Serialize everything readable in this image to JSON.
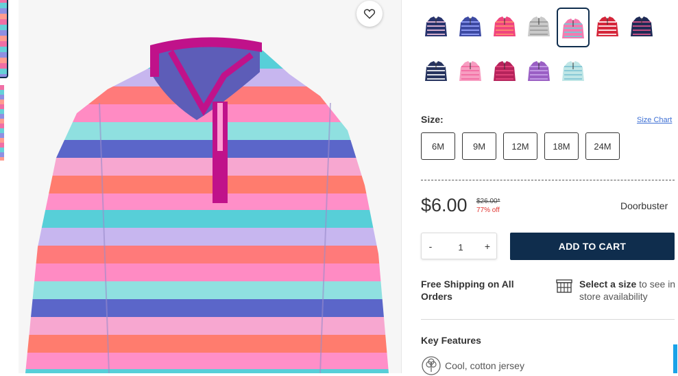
{
  "favorite": {
    "icon": "heart-icon"
  },
  "swatches": [
    {
      "name": "navy-unicorn",
      "color": "#27336d",
      "pattern": "#f6c6de"
    },
    {
      "name": "navy-print",
      "color": "#3d4aa3",
      "pattern": "#9aa6ff"
    },
    {
      "name": "pink-colorblock",
      "color": "#f0457e",
      "pattern": "#ff8f6d"
    },
    {
      "name": "gray-heart",
      "color": "#c9c9c9",
      "pattern": "#9b9b9b"
    },
    {
      "name": "rainbow-stripe",
      "color": "#f27bb0",
      "pattern": "#6fd0d8",
      "selected": true
    },
    {
      "name": "red-fairisle",
      "color": "#d5263a",
      "pattern": "#ffffff"
    },
    {
      "name": "navy-dot",
      "color": "#1f2b56",
      "pattern": "#e0568a"
    },
    {
      "name": "navy-stripe",
      "color": "#26335e",
      "pattern": "#ffffff"
    },
    {
      "name": "light-pink",
      "color": "#f79dc1",
      "pattern": "#f26aa0"
    },
    {
      "name": "berry-heart",
      "color": "#b6235b",
      "pattern": "#e5457c"
    },
    {
      "name": "purple-colorblock",
      "color": "#9a5fc4",
      "pattern": "#c8a3ea"
    },
    {
      "name": "mint-print",
      "color": "#bfe6e6",
      "pattern": "#7fc3d2"
    }
  ],
  "size": {
    "label": "Size:",
    "chart_link": "Size Chart",
    "options": [
      "6M",
      "9M",
      "12M",
      "18M",
      "24M"
    ]
  },
  "price": {
    "current": "$6.00",
    "original": "$26.00*",
    "discount": "77% off",
    "badge": "Doorbuster"
  },
  "quantity": {
    "minus": "-",
    "value": "1",
    "plus": "+"
  },
  "cart": {
    "button": "ADD TO CART"
  },
  "shipping": {
    "text": "Free Shipping on All Orders"
  },
  "store": {
    "icon": "store-icon",
    "link": "Select a size",
    "text": " to see in store availability"
  },
  "features": {
    "heading": "Key Features",
    "items": [
      {
        "icon": "cotton-icon",
        "text": "Cool, cotton jersey"
      }
    ]
  }
}
